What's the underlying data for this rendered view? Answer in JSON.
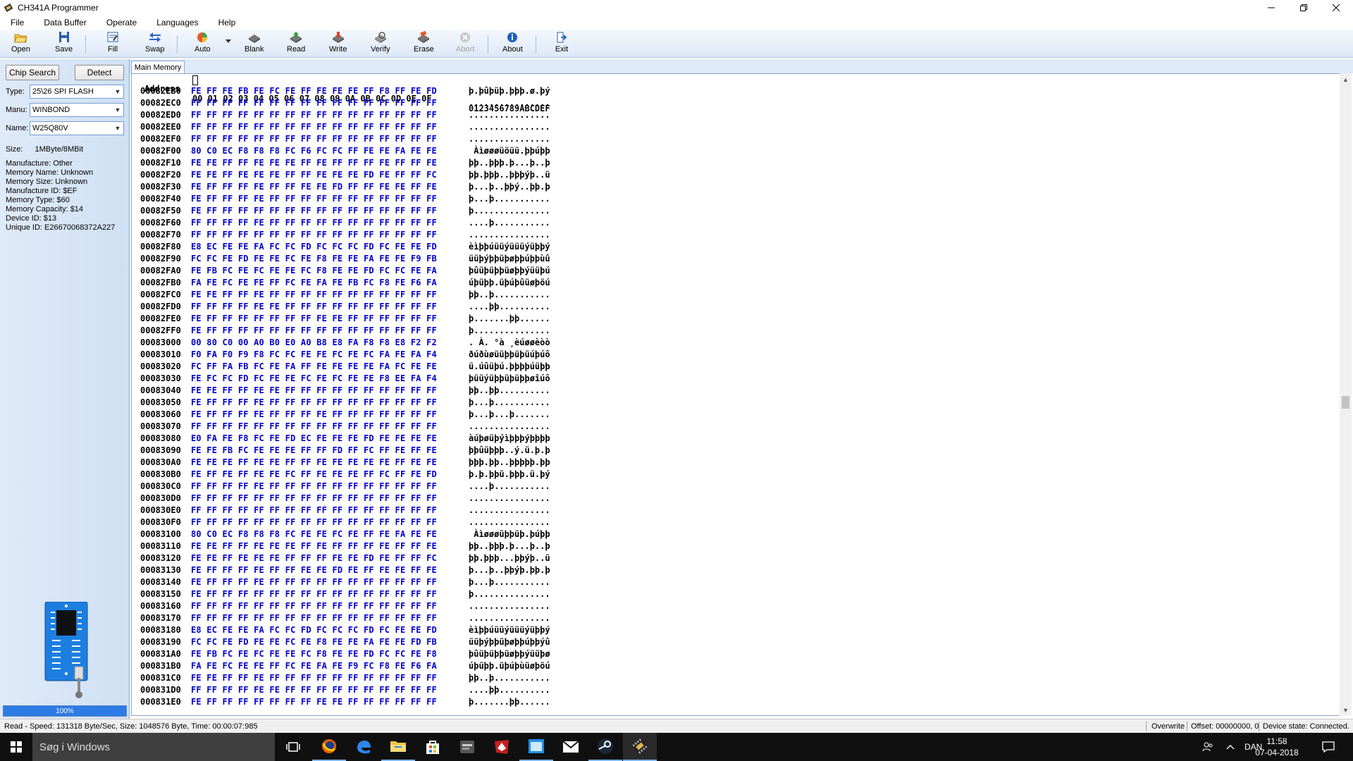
{
  "window": {
    "title": "CH341A Programmer"
  },
  "menu": [
    "File",
    "Data Buffer",
    "Operate",
    "Languages",
    "Help"
  ],
  "toolbar": [
    {
      "label": "Open",
      "icon": "folder-open-icon"
    },
    {
      "label": "Save",
      "icon": "floppy-save-icon"
    },
    {
      "label": "Fill",
      "icon": "fill-icon"
    },
    {
      "label": "Swap",
      "icon": "swap-arrows-icon"
    },
    {
      "label": "Auto",
      "icon": "auto-icon"
    },
    {
      "label": "Blank",
      "icon": "blank-check-icon"
    },
    {
      "label": "Read",
      "icon": "read-chip-icon"
    },
    {
      "label": "Write",
      "icon": "write-chip-icon"
    },
    {
      "label": "Verify",
      "icon": "verify-icon"
    },
    {
      "label": "Erase",
      "icon": "erase-icon"
    },
    {
      "label": "Abort",
      "icon": "abort-icon"
    },
    {
      "label": "About",
      "icon": "info-icon"
    },
    {
      "label": "Exit",
      "icon": "exit-icon"
    }
  ],
  "left": {
    "chip_search": "Chip Search",
    "detect": "Detect",
    "type_label": "Type:",
    "type_value": "25\\26 SPI FLASH",
    "manu_label": "Manu:",
    "manu_value": "WINBOND",
    "name_label": "Name:",
    "name_value": "W25Q80V",
    "size_label": "Size:",
    "size_value": "1MByte/8MBit",
    "info": [
      "Manufacture: Other",
      "Memory Name: Unknown",
      "Memory Size: Unknown",
      "Manufacture ID: $EF",
      "Memory Type: $60",
      "Memory Capacity: $14",
      "Device ID: $13",
      "Unique ID: E26670068372A227"
    ],
    "progress": "100%",
    "progress_fraction": 1.0
  },
  "tab": "Main Memory",
  "hex": {
    "header_address": "Address",
    "header_bytes": "00 01 02 03 04 05 06 07 08 09 0A 0B 0C 0D 0E 0F",
    "header_ascii": "0123456789ABCDEF",
    "rows": [
      [
        "00082EB0",
        "FE FF FE FB FE FC FE FF FE FE FE FF F8 FF FE FD",
        "þ.þûþüþ.þþþ.ø.þý"
      ],
      [
        "00082EC0",
        "FF FF FF FF FF FF FF FF FF FF FF FF FF FF FF FF",
        "................"
      ],
      [
        "00082ED0",
        "FF FF FF FF FF FF FF FF FF FF FF FF FF FF FF FF",
        "................"
      ],
      [
        "00082EE0",
        "FF FF FF FF FF FF FF FF FF FF FF FF FF FF FF FF",
        "................"
      ],
      [
        "00082EF0",
        "FF FF FF FF FF FF FF FF FF FF FF FF FF FF FF FF",
        "................"
      ],
      [
        "00082F00",
        "80 C0 EC F8 F8 F8 FC F6 FC FC FF FE FE FA FE FE",
        " Àìøøøüöüü.þþúþþ"
      ],
      [
        "00082F10",
        "FE FE FF FF FE FE FE FF FE FF FF FF FE FF FF FE",
        "þþ..þþþ.þ...þ..þ"
      ],
      [
        "00082F20",
        "FE FE FF FE FE FE FF FF FE FE FE FD FE FF FF FC",
        "þþ.þþþ..þþþýþ..ü"
      ],
      [
        "00082F30",
        "FE FF FF FF FE FF FF FE FE FD FF FF FE FE FF FE",
        "þ...þ..þþý..þþ.þ"
      ],
      [
        "00082F40",
        "FE FF FF FF FE FF FF FF FF FF FF FF FF FF FF FF",
        "þ...þ..........."
      ],
      [
        "00082F50",
        "FE FF FF FF FF FF FF FF FF FF FF FF FF FF FF FF",
        "þ..............."
      ],
      [
        "00082F60",
        "FF FF FF FF FE FF FF FF FF FF FF FF FF FF FF FF",
        "....þ..........."
      ],
      [
        "00082F70",
        "FF FF FF FF FF FF FF FF FF FF FF FF FF FF FF FF",
        "................"
      ],
      [
        "00082F80",
        "E8 EC FE FE FA FC FC FD FC FC FC FD FC FE FE FD",
        "èìþþúüüýüüüýüþþý"
      ],
      [
        "00082F90",
        "FC FC FE FD FE FE FC FE F8 FE FE FA FE FE F9 FB",
        "üüþýþþüþøþþúþþùû"
      ],
      [
        "00082FA0",
        "FE FB FC FE FC FE FE FC F8 FE FE FD FC FC FE FA",
        "þûüþüþþüøþþýüüþú"
      ],
      [
        "00082FB0",
        "FA FE FC FE FE FF FC FE FA FE FB FC F8 FE F6 FA",
        "úþüþþ.üþúþûüøþöú"
      ],
      [
        "00082FC0",
        "FE FE FF FF FE FF FF FF FF FF FF FF FF FF FF FF",
        "þþ..þ..........."
      ],
      [
        "00082FD0",
        "FF FF FF FF FE FE FF FF FF FF FF FF FF FF FF FF",
        "....þþ.........."
      ],
      [
        "00082FE0",
        "FE FF FF FF FF FF FF FF FE FE FF FF FF FF FF FF",
        "þ.......þþ......"
      ],
      [
        "00082FF0",
        "FE FF FF FF FF FF FF FF FF FF FF FF FF FF FF FF",
        "þ..............."
      ],
      [
        "00083000",
        "00 80 C0 00 A0 B0 E0 A0 B8 E8 FA F8 F8 E8 F2 F2",
        ". À. °à ¸èúøøèòò"
      ],
      [
        "00083010",
        "F0 FA F0 F9 F8 FC FC FE FE FC FE FC FA FE FA F4",
        "ðúðùøüüþþüþüúþúô"
      ],
      [
        "00083020",
        "FC FF FA FB FC FE FA FF FE FE FE FE FA FC FE FE",
        "ü.úûüþú.þþþþúüþþ"
      ],
      [
        "00083030",
        "FE FC FC FD FC FE FE FC FE FC FE FE F8 EE FA F4",
        "þüüýüþþüþüþþøîúô"
      ],
      [
        "00083040",
        "FE FE FF FF FE FE FF FF FF FF FF FF FF FF FF FF",
        "þþ..þþ.........."
      ],
      [
        "00083050",
        "FE FF FF FF FE FF FF FF FF FF FF FF FF FF FF FF",
        "þ...þ..........."
      ],
      [
        "00083060",
        "FE FF FF FF FE FF FF FF FE FF FF FF FF FF FF FF",
        "þ...þ...þ......."
      ],
      [
        "00083070",
        "FF FF FF FF FF FF FF FF FF FF FF FF FF FF FF FF",
        "................"
      ],
      [
        "00083080",
        "E0 FA FE F8 FC FE FD EC FE FE FE FD FE FE FE FE",
        "àúþøüþýìþþþýþþþþ"
      ],
      [
        "00083090",
        "FE FE FB FC FE FE FE FF FF FD FF FC FF FE FF FE",
        "þþûüþþþ..ý.ü.þ.þ"
      ],
      [
        "000830A0",
        "FE FE FE FF FE FE FF FF FE FE FE FE FE FF FE FE",
        "þþþ.þþ..þþþþþ.þþ"
      ],
      [
        "000830B0",
        "FE FF FE FF FE FE FC FF FE FE FE FF FC FF FE FD",
        "þ.þ.þþü.þþþ.ü.þý"
      ],
      [
        "000830C0",
        "FF FF FF FF FE FF FF FF FF FF FF FF FF FF FF FF",
        "....þ..........."
      ],
      [
        "000830D0",
        "FF FF FF FF FF FF FF FF FF FF FF FF FF FF FF FF",
        "................"
      ],
      [
        "000830E0",
        "FF FF FF FF FF FF FF FF FF FF FF FF FF FF FF FF",
        "................"
      ],
      [
        "000830F0",
        "FF FF FF FF FF FF FF FF FF FF FF FF FF FF FF FF",
        "................"
      ],
      [
        "00083100",
        "80 C0 EC F8 F8 F8 FC FE FE FC FE FF FE FA FE FE",
        " Àìøøøüþþüþ.þúþþ"
      ],
      [
        "00083110",
        "FE FE FF FF FE FE FE FF FE FF FF FF FE FF FF FE",
        "þþ..þþþ.þ...þ..þ"
      ],
      [
        "00083120",
        "FE FE FF FE FE FE FF FF FF FE FE FD FE FF FF FC",
        "þþ.þþþ...þþýþ..ü"
      ],
      [
        "00083130",
        "FE FF FF FF FE FF FF FE FE FD FE FF FE FE FF FE",
        "þ...þ..þþýþ.þþ.þ"
      ],
      [
        "00083140",
        "FE FF FF FF FE FF FF FF FF FF FF FF FF FF FF FF",
        "þ...þ..........."
      ],
      [
        "00083150",
        "FE FF FF FF FF FF FF FF FF FF FF FF FF FF FF FF",
        "þ..............."
      ],
      [
        "00083160",
        "FF FF FF FF FF FF FF FF FF FF FF FF FF FF FF FF",
        "................"
      ],
      [
        "00083170",
        "FF FF FF FF FF FF FF FF FF FF FF FF FF FF FF FF",
        "................"
      ],
      [
        "00083180",
        "E8 EC FE FE FA FC FC FD FC FC FC FD FC FE FE FD",
        "èìþþúüüýüüüýüþþý"
      ],
      [
        "00083190",
        "FC FC FE FD FE FE FC FE F8 FE FE FA FE FE FD FB",
        "üüþýþþüþøþþúþþýû"
      ],
      [
        "000831A0",
        "FE FB FC FE FC FE FE FC F8 FE FE FD FC FC FE F8",
        "þûüþüþþüøþþýüüþø"
      ],
      [
        "000831B0",
        "FA FE FC FE FE FF FC FE FA FE F9 FC F8 FE F6 FA",
        "úþüþþ.üþúþùüøþöú"
      ],
      [
        "000831C0",
        "FE FE FF FF FE FF FF FF FF FF FF FF FF FF FF FF",
        "þþ..þ..........."
      ],
      [
        "000831D0",
        "FF FF FF FF FE FE FF FF FF FF FF FF FF FF FF FF",
        "....þþ.........."
      ],
      [
        "000831E0",
        "FE FF FF FF FF FF FF FF FE FE FF FF FF FF FF FF",
        "þ.......þþ......"
      ]
    ]
  },
  "status": {
    "left": "Read - Speed: 131318 Byte/Sec, Size: 1048576 Byte, Time: 00:00:07:985",
    "mode": "Overwrite",
    "offset": "Offset: 00000000, 0",
    "device": "Device state: Connected."
  },
  "taskbar": {
    "search_placeholder": "Søg i Windows",
    "lang": "DAN",
    "time": "11:58",
    "date": "07-04-2018"
  },
  "colors": {
    "hex_bytes": "#0000cc",
    "toolbar_bg": "#dde8f6",
    "panel_bg": "#cfe0f4",
    "progress": "#2d7be4"
  }
}
